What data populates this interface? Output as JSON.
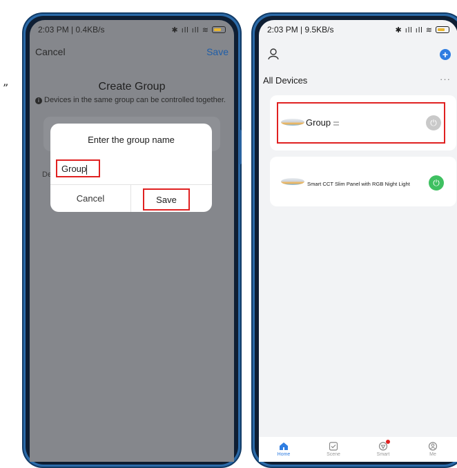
{
  "stray_text": "”",
  "left_phone": {
    "status": {
      "time": "2:03 PM | 0.4KB/s",
      "icons": "✱ ıll ıll ≋"
    },
    "nav": {
      "cancel": "Cancel",
      "save": "Save"
    },
    "title": "Create Group",
    "info": "Devices in the same group can be controlled together.",
    "behind_label": "De",
    "dialog": {
      "title": "Enter the group name",
      "input_value": "Group",
      "cancel": "Cancel",
      "save": "Save"
    }
  },
  "right_phone": {
    "status": {
      "time": "2:03 PM | 9.5KB/s",
      "icons": "✱ ıll ıll ≋"
    },
    "section_title": "All Devices",
    "more": "···",
    "add_icon": "+",
    "devices": [
      {
        "name": "Group",
        "power": "off"
      },
      {
        "name": "Smart CCT Slim Panel with RGB Night Light",
        "power": "on"
      }
    ],
    "tabs": [
      {
        "label": "Home",
        "icon": "home-icon",
        "active": true
      },
      {
        "label": "Scene",
        "icon": "scene-icon",
        "active": false
      },
      {
        "label": "Smart",
        "icon": "smart-icon",
        "active": false
      },
      {
        "label": "Me",
        "icon": "me-icon",
        "active": false
      }
    ],
    "colors": {
      "accent": "#2f7de1",
      "power_on": "#3fc061",
      "power_off": "#c9c9c9",
      "highlight": "#e02020"
    }
  }
}
